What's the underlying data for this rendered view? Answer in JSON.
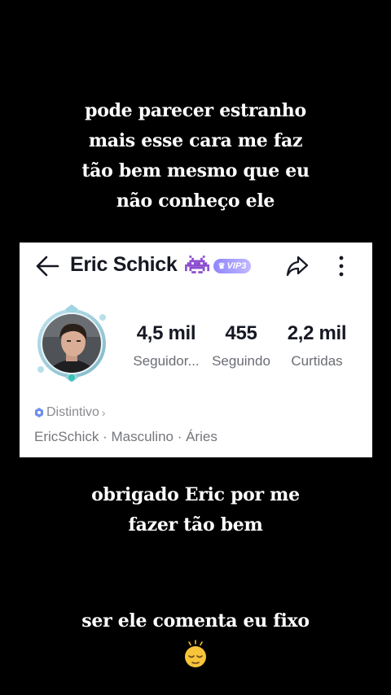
{
  "captions": {
    "top": [
      "pode parecer estranho",
      "mais esse cara me faz",
      "tão bem mesmo que eu",
      "não conheço ele"
    ],
    "middle": [
      "obrigado Eric por me",
      "fazer tão bem"
    ],
    "bottom": [
      "ser ele comenta eu fixo"
    ]
  },
  "emoji": "sleepy-relieved-face",
  "profile": {
    "name": "Eric Schick",
    "vip_label": "VIP3",
    "stats": [
      {
        "value": "4,5 mil",
        "label": "Seguidor..."
      },
      {
        "value": "455",
        "label": "Seguindo"
      },
      {
        "value": "2,2 mil",
        "label": "Curtidas"
      }
    ],
    "badge_label": "Distintivo",
    "details": "EricSchick · Masculino · Áries"
  },
  "icons": [
    "back-arrow-icon",
    "alien-monster-icon",
    "crown-icon",
    "share-icon",
    "more-vertical-icon",
    "badge-icon",
    "chevron-right-icon"
  ],
  "colors": {
    "background": "#000000",
    "card": "#ffffff",
    "vip": "#9d94ff",
    "text": "#161823",
    "muted": "#75767d"
  }
}
